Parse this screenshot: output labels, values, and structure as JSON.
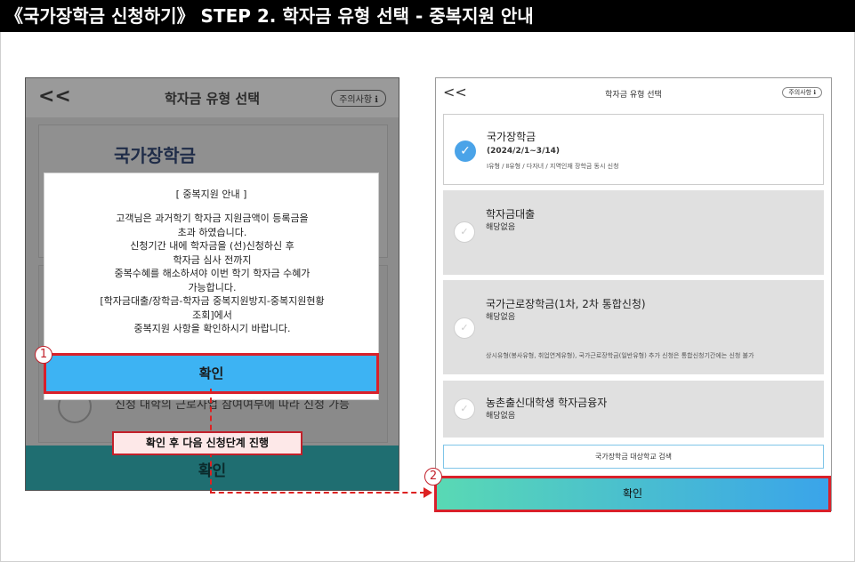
{
  "header": {
    "title": "《국가장학금 신청하기》 STEP 2. 학자금 유형 선택 - 중복지원 안내"
  },
  "left_phone": {
    "back": "<<",
    "title": "학자금 유형 선택",
    "notice": "주의사항 ℹ",
    "card_title": "국가장학금",
    "background_text": "신청 대학의 근로사업 참여여부에 따라 신청 가능",
    "bottom_button": "확인",
    "modal": {
      "title": "[ 중복지원 안내 ]",
      "lines": [
        "고객님은 과거학기 학자금 지원금액이 등록금을",
        "초과 하였습니다.",
        "신청기간 내에 학자금을 (선)신청하신 후",
        "학자금 심사 전까지",
        "중복수혜를 해소하셔야 이번 학기 학자금 수혜가",
        "가능합니다.",
        "[학자금대출/장학금-학자금 중복지원방지-중복지원현황",
        "조회]에서",
        "중복지원 사항을 확인하시기 바랍니다."
      ],
      "confirm": "확인"
    }
  },
  "annotations": {
    "marker1": "1",
    "marker2": "2",
    "callout": "확인 후 다음 신청단계 진행"
  },
  "right_phone": {
    "back": "<<",
    "title": "학자금 유형 선택",
    "notice": "주의사항 ℹ",
    "cards": [
      {
        "title": "국가장학금",
        "sub": "(2024/2/1~3/14)",
        "note": "Ⅰ유형 / Ⅱ유형 / 다자녀 / 지역인재 장학금 동시 신청"
      },
      {
        "title": "학자금대출",
        "sub": "해당없음"
      },
      {
        "title": "국가근로장학금(1차, 2차 통합신청)",
        "sub": "해당없음",
        "note": "상시유형(봉사유형, 취업연계유형), 국가근로장학금(일반유형) 추가 신청은 통합신청기간에는 신청 불가"
      },
      {
        "title": "농촌출신대학생 학자금융자",
        "sub": "해당없음"
      }
    ],
    "search": "국가장학금 대상학교 검색",
    "confirm": "확인"
  },
  "colors": {
    "accent_blue": "#3db3f3",
    "highlight_red": "#d9202a",
    "gradient_start": "#59d9b4",
    "gradient_end": "#3aa4ea"
  }
}
